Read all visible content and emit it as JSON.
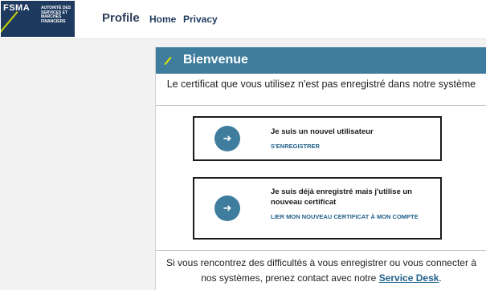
{
  "header": {
    "logo_text": "FSMA",
    "logo_tagline": "AUTORITÉ DES SERVICES ET MARCHÉS FINANCIERS",
    "app_title": "Profile",
    "nav": {
      "home": "Home",
      "privacy": "Privacy"
    }
  },
  "main": {
    "title": "Bienvenue",
    "intro": "Le certificat que vous utilisez n'est pas enregistré dans notre système",
    "options": [
      {
        "heading": "Je suis un nouvel utilisateur",
        "link": "S'ENREGISTRER",
        "icon": "arrow-right-icon"
      },
      {
        "heading": "Je suis déjà enregistré mais j'utilise un nouveau certificat",
        "link": "LIER MON NOUVEAU CERTIFICAT À MON COMPTE",
        "icon": "arrow-right-icon"
      }
    ],
    "footer_text": "Si vous rencontrez des difficultés à vous enregistrer ou vous connecter à nos systèmes, prenez contact avec notre",
    "footer_link": "Service Desk",
    "footer_end": "."
  },
  "colors": {
    "brand_navy": "#1f3a5f",
    "accent_lime": "#c8d400",
    "header_blue": "#3f7d9e",
    "link_blue": "#1f5f8a"
  }
}
